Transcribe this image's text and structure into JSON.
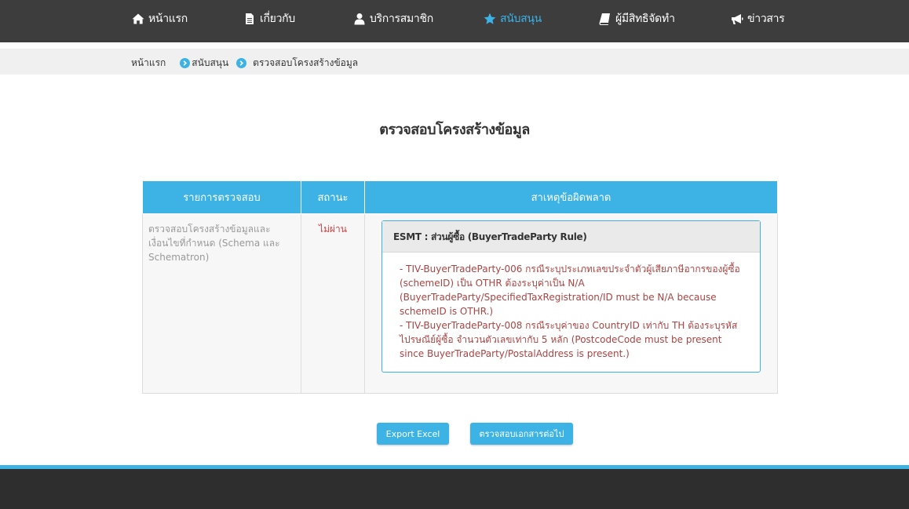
{
  "nav": {
    "items": [
      {
        "label": "หน้าแรก",
        "icon": "home-icon"
      },
      {
        "label": "เกี่ยวกับ",
        "icon": "document-icon"
      },
      {
        "label": "บริการสมาชิก",
        "icon": "user-icon"
      },
      {
        "label": "สนับสนุน",
        "icon": "star-icon",
        "active": true
      },
      {
        "label": "ผู้มีสิทธิจัดทำ",
        "icon": "book-icon"
      },
      {
        "label": "ข่าวสาร",
        "icon": "megaphone-icon"
      }
    ],
    "active_color": "#3db2e4",
    "bar_color": "#3d3d3d"
  },
  "breadcrumb": {
    "items": [
      "หน้าแรก",
      "สนับสนุน",
      "ตรวจสอบโครงสร้างข้อมูล"
    ]
  },
  "page": {
    "title": "ตรวจสอบโครงสร้างข้อมูล"
  },
  "table": {
    "headers": [
      "รายการตรวจสอบ",
      "สถานะ",
      "สาเหตุข้อผิดพลาด"
    ],
    "row": {
      "item": "ตรวจสอบโครงสร้างข้อมูลและเงื่อนไขที่กำหนด (Schema และ Schematron)",
      "status": "ไม่ผ่าน",
      "error_panel": {
        "title": "ESMT : ส่วนผู้ซื้อ (BuyerTradeParty Rule)",
        "messages": [
          "- TIV-BuyerTradeParty-006 กรณีระบุประเภทเลขประจำตัวผู้เสียภาษีอากรของผู้ซื้อ (schemeID) เป็น OTHR ต้องระบุค่าเป็น N/A (BuyerTradeParty/SpecifiedTaxRegistration/ID must be N/A because schemeID is OTHR.)",
          "- TIV-BuyerTradeParty-008 กรณีระบุค่าของ CountryID เท่ากับ TH ต้องระบุรหัสไปรษณีย์ผู้ซื้อ จำนวนตัวเลขเท่ากับ 5 หลัก (PostcodeCode must be present since BuyerTradeParty/PostalAddress is present.)"
        ]
      }
    },
    "header_color": "#3db2e4",
    "status_color": "#d24040",
    "error_color": "#a94442"
  },
  "buttons": {
    "export_excel": "Export Excel",
    "check_next": "ตรวจสอบเอกสารต่อไป"
  }
}
